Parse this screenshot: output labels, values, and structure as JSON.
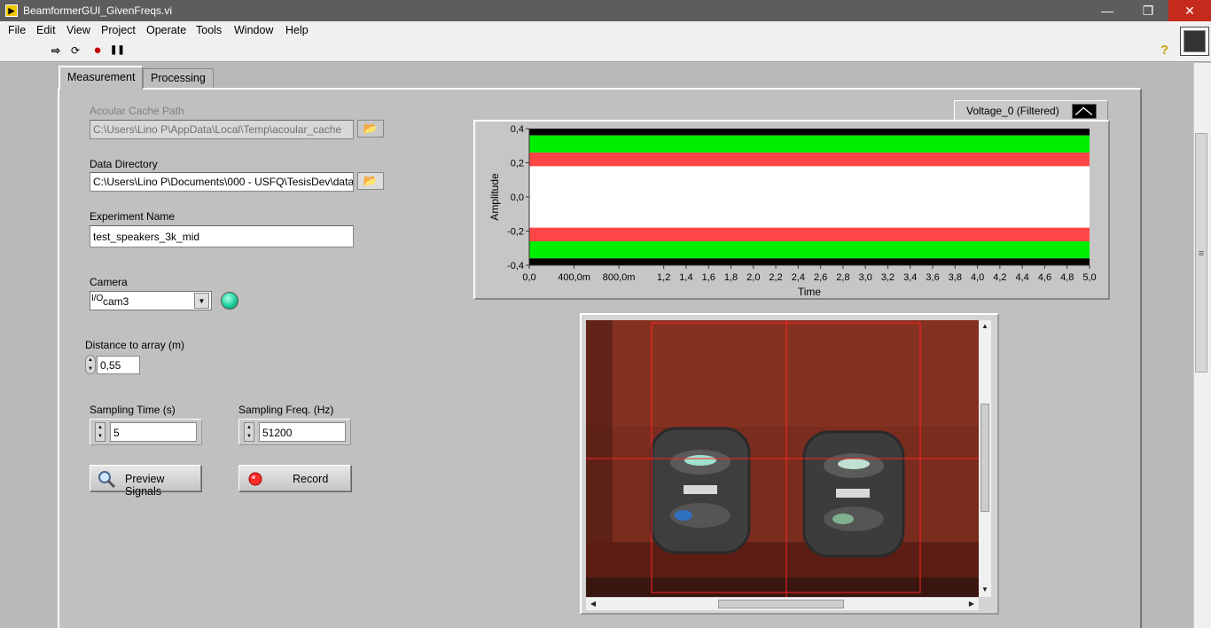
{
  "window": {
    "title": "BeamformerGUI_GivenFreqs.vi",
    "app_icon_glyph": "▶",
    "min_glyph": "—",
    "max_glyph": "❐",
    "close_glyph": "✕"
  },
  "menu": [
    "File",
    "Edit",
    "View",
    "Project",
    "Operate",
    "Tools",
    "Window",
    "Help"
  ],
  "toolbar": {
    "run_glyph": "⇨",
    "run_continuous_glyph": "⟳",
    "abort_glyph": "●",
    "pause_glyph": "❚❚",
    "help_glyph": "?"
  },
  "tabs": [
    {
      "label": "Measurement",
      "selected": true
    },
    {
      "label": "Processing",
      "selected": false
    }
  ],
  "measurement": {
    "cache_path": {
      "label": "Acoular Cache Path",
      "value": "C:\\Users\\Lino P\\AppData\\Local\\Temp\\acoular_cache"
    },
    "data_dir": {
      "label": "Data Directory",
      "value": "C:\\Users\\Lino P\\Documents\\000 - USFQ\\TesisDev\\data"
    },
    "experiment": {
      "label": "Experiment Name",
      "value": "test_speakers_3k_mid"
    },
    "camera": {
      "label": "Camera",
      "prefix": "I/O",
      "value": "cam3",
      "led_color": "#1bcf9a"
    },
    "distance": {
      "label": "Distance to array (m)",
      "value": "0,55"
    },
    "sampling_time": {
      "label": "Sampling Time (s)",
      "value": "5"
    },
    "sampling_freq": {
      "label": "Sampling Freq. (Hz)",
      "value": "51200"
    },
    "preview_button": "Preview Signals",
    "record_button": "Record",
    "folder_glyph": "📂"
  },
  "chart_data": {
    "type": "line",
    "legend": [
      "Voltage_0 (Filtered)"
    ],
    "xlabel": "Time",
    "ylabel": "Amplitude",
    "xlim": [
      0,
      5.0
    ],
    "ylim": [
      -0.4,
      0.4
    ],
    "x_ticks": [
      "0,0",
      "400,0m",
      "800,0m",
      "1,2",
      "1,4",
      "1,6",
      "1,8",
      "2,0",
      "2,2",
      "2,4",
      "2,6",
      "2,8",
      "3,0",
      "3,2",
      "3,4",
      "3,6",
      "3,8",
      "4,0",
      "4,2",
      "4,4",
      "4,6",
      "4,8",
      "5,0"
    ],
    "x_tick_values": [
      0,
      0.4,
      0.8,
      1.2,
      1.4,
      1.6,
      1.8,
      2.0,
      2.2,
      2.4,
      2.6,
      2.8,
      3.0,
      3.2,
      3.4,
      3.6,
      3.8,
      4.0,
      4.2,
      4.4,
      4.6,
      4.8,
      5.0
    ],
    "y_ticks": [
      "0,4",
      "0,2",
      "0,0",
      "-0,2",
      "-0,4"
    ],
    "y_tick_values": [
      0.4,
      0.2,
      0,
      -0.2,
      -0.4
    ],
    "series_bands": [
      {
        "color": "#000000",
        "from": 0.36,
        "to": 0.4
      },
      {
        "color": "#00ee00",
        "from": 0.26,
        "to": 0.36
      },
      {
        "color": "#ff4646",
        "from": 0.18,
        "to": 0.26
      },
      {
        "color": "#ff4646",
        "from": -0.26,
        "to": -0.18
      },
      {
        "color": "#00ee00",
        "from": -0.36,
        "to": -0.26
      },
      {
        "color": "#000000",
        "from": -0.4,
        "to": -0.36
      }
    ]
  },
  "colors": {
    "crosshair": "#ff2020",
    "accent_green": "#00ee00",
    "accent_red": "#ff4646"
  }
}
